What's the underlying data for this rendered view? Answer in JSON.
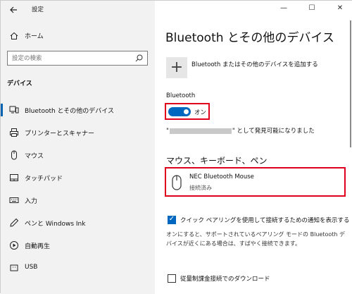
{
  "window": {
    "title": "設定",
    "minimize": "—",
    "maximize": "☐",
    "close": "✕"
  },
  "sidebar": {
    "home_label": "ホーム",
    "search_placeholder": "設定の検索",
    "section_title": "デバイス",
    "items": [
      {
        "label": "Bluetooth とその他のデバイス",
        "icon": "bluetooth-devices-icon",
        "selected": true
      },
      {
        "label": "プリンターとスキャナー",
        "icon": "printer-icon"
      },
      {
        "label": "マウス",
        "icon": "mouse-icon"
      },
      {
        "label": "タッチパッド",
        "icon": "touchpad-icon"
      },
      {
        "label": "入力",
        "icon": "keyboard-icon"
      },
      {
        "label": "ペンと Windows Ink",
        "icon": "pen-icon"
      },
      {
        "label": "自動再生",
        "icon": "autoplay-icon"
      },
      {
        "label": "USB",
        "icon": "usb-icon"
      }
    ]
  },
  "main": {
    "page_title": "Bluetooth とその他のデバイス",
    "add_device_label": "Bluetooth またはその他のデバイスを追加する",
    "bluetooth_heading": "Bluetooth",
    "toggle_state": "オン",
    "discoverable_prefix": "\"",
    "discoverable_suffix": "\" として発見可能になりました",
    "mouse_section_heading": "マウス、キーボード、ペン",
    "device": {
      "name": "NEC Bluetooth Mouse",
      "status": "接続済み"
    },
    "swift_pair": {
      "checked": true,
      "label": "クイック ペアリングを使用して接続するための通知を表示する",
      "description": "オンにすると、サポートされているペアリング モードの Bluetooth デバイスが近くにある場合は、すばやく接続できます。"
    },
    "metered": {
      "checked": false,
      "label": "従量制課金接続でのダウンロード"
    }
  },
  "colors": {
    "accent": "#0067c0",
    "highlight_border": "#e0001b",
    "sidebar_bg": "#f2f2f2"
  }
}
